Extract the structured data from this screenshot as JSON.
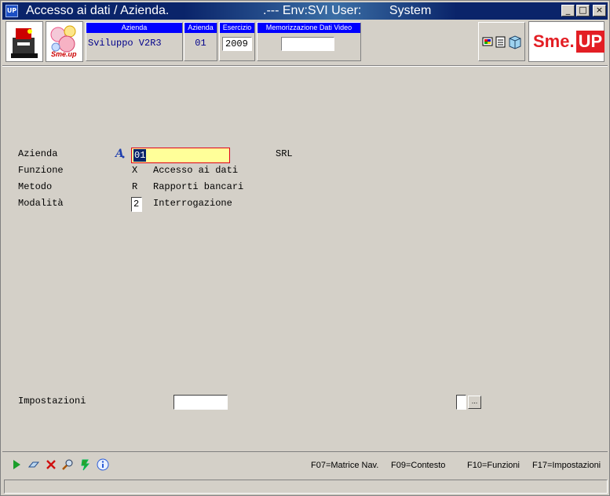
{
  "window": {
    "title": "Accesso ai dati / Azienda.",
    "title_suffix": ".--- Env:SVI User:",
    "title_system": "System",
    "app_icon": "UP",
    "controls": {
      "minimize": "_",
      "maximize": "□",
      "close": "×"
    }
  },
  "header": {
    "azienda_panel": {
      "label": "Azienda",
      "value": "Sviluppo V2R3"
    },
    "azienda_code_panel": {
      "label": "Azienda",
      "value": "01"
    },
    "esercizio_panel": {
      "label": "Esercizio",
      "value": "2009"
    },
    "memo_panel": {
      "label": "Memorizzazione Dati Video",
      "value": ""
    },
    "brand_logo": {
      "sme": "Sme.",
      "up": "UP"
    },
    "small_logo_text": "Sme.up"
  },
  "form": {
    "azienda": {
      "label": "Azienda",
      "value": "01",
      "desc": "SRL"
    },
    "funzione": {
      "label": "Funzione",
      "code": "X",
      "desc": "Accesso ai dati"
    },
    "metodo": {
      "label": "Metodo",
      "code": "R",
      "desc": "Rapporti bancari"
    },
    "modalita": {
      "label": "Modalità",
      "value": "2",
      "desc": "Interrogazione"
    },
    "impostazioni": {
      "label": "Impostazioni",
      "value": "",
      "browse": "..."
    }
  },
  "bottombar": {
    "fkeys": [
      "F07=Matrice Nav.",
      "F09=Contesto",
      "F10=Funzioni",
      "F17=Impostazioni"
    ]
  },
  "colors": {
    "title_bar": "#0a246a",
    "panel_head": "#0000ff",
    "field_highlight": "#ffff99",
    "brand_red": "#e31e24"
  }
}
